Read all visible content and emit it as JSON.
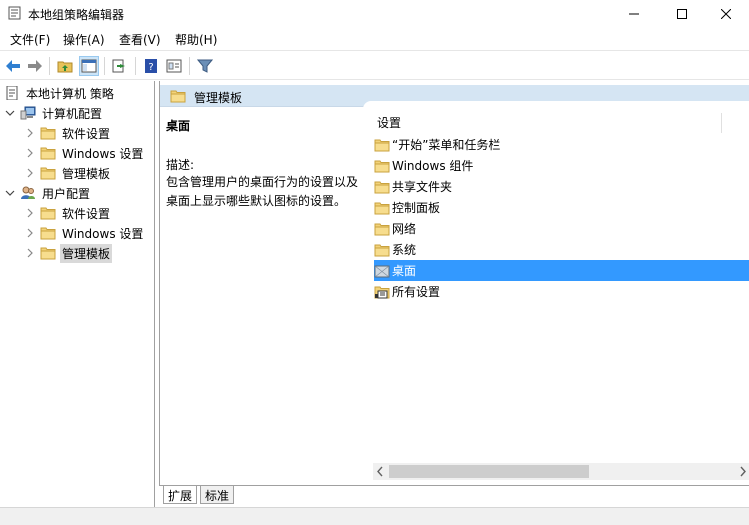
{
  "window": {
    "title": "本地组策略编辑器"
  },
  "menu": {
    "file": "文件(F)",
    "action": "操作(A)",
    "view": "查看(V)",
    "help": "帮助(H)"
  },
  "tree": {
    "root": "本地计算机 策略",
    "computer_config": "计算机配置",
    "cc_software": "软件设置",
    "cc_windows": "Windows 设置",
    "cc_admin": "管理模板",
    "user_config": "用户配置",
    "uc_software": "软件设置",
    "uc_windows": "Windows 设置",
    "uc_admin": "管理模板"
  },
  "right": {
    "header_title": "管理模板",
    "desc_title": "桌面",
    "desc_label": "描述:",
    "desc_line1": "包含管理用户的桌面行为的设置以及",
    "desc_line2": "桌面上显示哪些默认图标的设置。",
    "list_header": "设置",
    "items": [
      {
        "label": "“开始”菜单和任务栏"
      },
      {
        "label": "Windows 组件"
      },
      {
        "label": "共享文件夹"
      },
      {
        "label": "控制面板"
      },
      {
        "label": "网络"
      },
      {
        "label": "系统"
      },
      {
        "label": "桌面"
      },
      {
        "label": "所有设置"
      }
    ]
  },
  "tabs": {
    "extended": "扩展",
    "standard": "标准"
  },
  "colors": {
    "selection": "#3399ff",
    "header_bg": "#d5e5f3",
    "folder": "#e8c35a"
  }
}
